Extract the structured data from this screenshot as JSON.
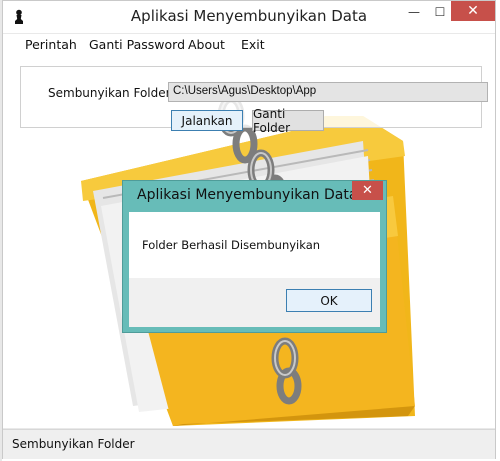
{
  "window": {
    "title": "Aplikasi Menyembunyikan Data",
    "minimize_glyph": "—",
    "maximize_glyph": "☐",
    "close_glyph": "✕"
  },
  "menu": {
    "items": [
      "Perintah",
      "Ganti Password",
      "About",
      "Exit"
    ]
  },
  "form": {
    "folder_label": "Sembunyikan Folder",
    "folder_path": "C:\\Users\\Agus\\Desktop\\App",
    "run_button": "Jalankan",
    "change_button": "Ganti Folder"
  },
  "status": {
    "text": "Sembunyikan Folder"
  },
  "dialog": {
    "title": "Aplikasi Menyembunyikan Data",
    "message": "Folder Berhasil Disembunyikan",
    "ok_label": "OK",
    "close_glyph": "✕"
  },
  "icons": {
    "app": "chess-pawn-icon",
    "illustration": "locked-folder-chain-icon"
  },
  "colors": {
    "close_red": "#c7504a",
    "dialog_frame": "#67bcb8",
    "focus_border": "#3c7fb1",
    "folder_yellow": "#f1b61a"
  }
}
